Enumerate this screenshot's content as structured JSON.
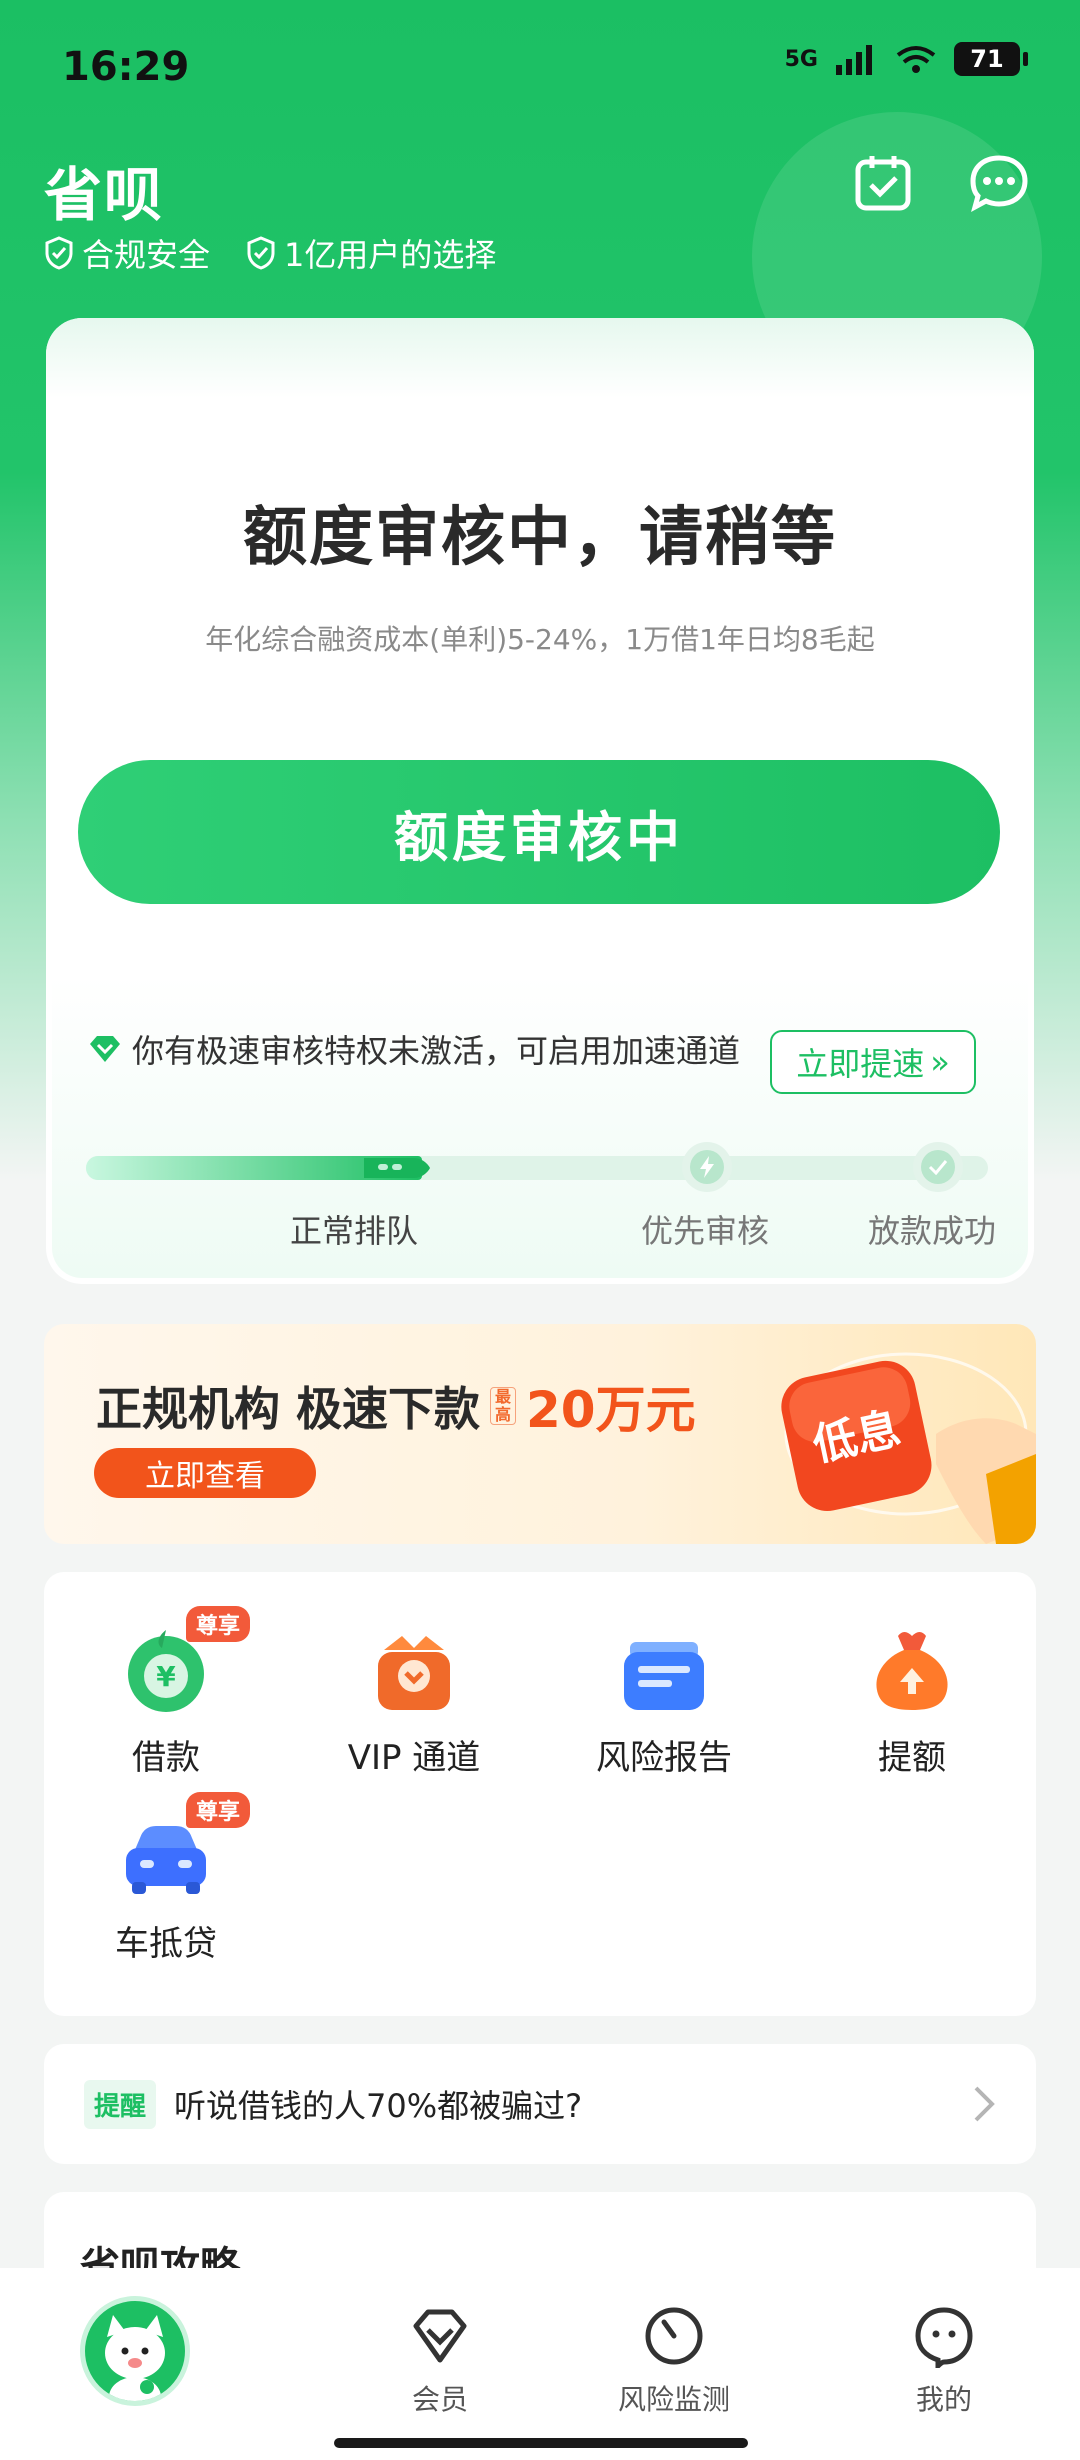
{
  "status_bar": {
    "time": "16:29",
    "network": "5G",
    "battery": "71"
  },
  "header": {
    "brand": "省呗",
    "badges": [
      "合规安全",
      "1亿用户的选择"
    ],
    "icons": [
      "calendar-check-icon",
      "chat-icon"
    ]
  },
  "main_card": {
    "title": "额度审核中，请稍等",
    "subtitle": "年化综合融资成本(单利)5-24%，1万借1年日均8毛起",
    "button_label": "额度审核中",
    "privilege_text": "你有极速审核特权未激活，可启用加速通道",
    "speed_button": "立即提速",
    "speed_button_arrow": "»",
    "steps": [
      "正常排队",
      "优先审核",
      "放款成功"
    ],
    "progress": 0.33
  },
  "promo": {
    "title": "正规机构 极速下款",
    "tag": "最高",
    "amount": "20万元",
    "button": "立即查看",
    "art_label": "低息"
  },
  "services": [
    {
      "label": "借款",
      "badge": "尊享",
      "icon": "yuan-coin-icon"
    },
    {
      "label": "VIP 通道",
      "badge": "",
      "icon": "vip-envelope-icon"
    },
    {
      "label": "风险报告",
      "badge": "",
      "icon": "report-folder-icon"
    },
    {
      "label": "提额",
      "badge": "",
      "icon": "money-bag-icon"
    },
    {
      "label": "车抵贷",
      "badge": "尊享",
      "icon": "car-icon"
    }
  ],
  "notice": {
    "tag": "提醒",
    "text": "听说借钱的人70%都被骗过?"
  },
  "guide": {
    "title": "省呗攻略"
  },
  "tabbar": {
    "items": [
      {
        "label": "",
        "icon": "mascot-home-icon"
      },
      {
        "label": "会员",
        "icon": "diamond-icon"
      },
      {
        "label": "风险监测",
        "icon": "gauge-icon"
      },
      {
        "label": "我的",
        "icon": "profile-face-icon"
      }
    ]
  },
  "colors": {
    "brand_green": "#1dbf63",
    "accent_orange": "#f2541b",
    "badge_red": "#f25a3a"
  }
}
